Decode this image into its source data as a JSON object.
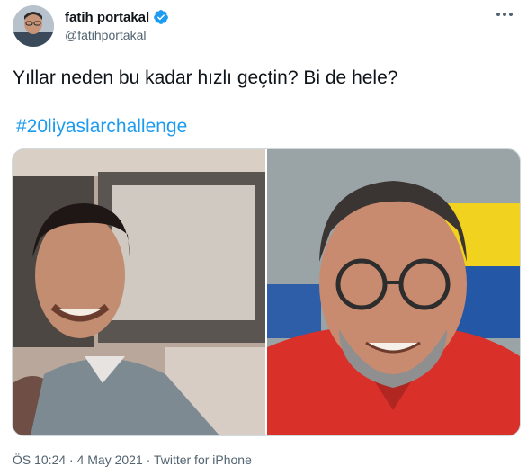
{
  "author": {
    "display_name": "fatih portakal",
    "handle": "@fatihportakal",
    "verified": true
  },
  "tweet": {
    "text": "Yıllar neden bu kadar hızlı geçtin? Bi de hele?",
    "hashtag": "#20liyaslarchallenge",
    "timestamp": "ÖS 10:24 · 4 May 2021 · Twitter for iPhone"
  },
  "icons": {
    "verified": "verified-badge-icon",
    "more": "more-options-icon"
  },
  "colors": {
    "link": "#1d9bf0",
    "secondary_text": "#536471",
    "verified": "#1d9bf0"
  }
}
